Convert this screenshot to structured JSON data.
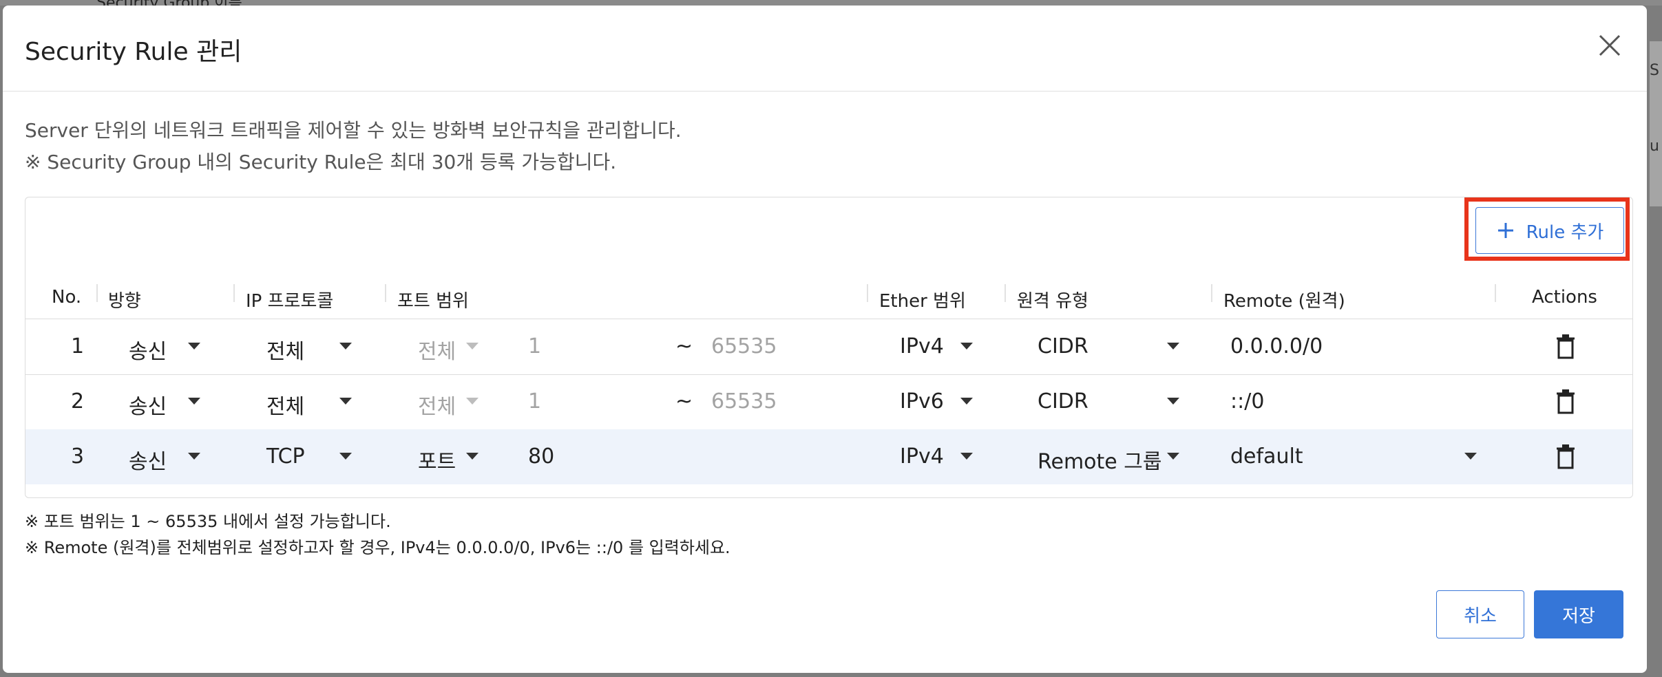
{
  "backdrop": {
    "top_text": "Security Group 이름",
    "right_letter_1": "S",
    "right_letter_2": "u"
  },
  "modal": {
    "title": "Security Rule 관리",
    "description_1": "Server 단위의 네트워크 트래픽을 제어할 수 있는 방화벽 보안규칙을 관리합니다.",
    "description_2": "※ Security Group 내의 Security Rule은 최대 30개 등록 가능합니다.",
    "add_rule_label": "Rule 추가",
    "columns": {
      "no": "No.",
      "direction": "방향",
      "protocol": "IP 프로토콜",
      "port_range": "포트 범위",
      "ether": "Ether 범위",
      "remote_type": "원격 유형",
      "remote": "Remote (원격)",
      "actions": "Actions"
    },
    "rows": [
      {
        "no": "1",
        "direction": "송신",
        "protocol": "전체",
        "port_type": "전체",
        "port_from": "1",
        "tilde": "~",
        "port_to": "65535",
        "ether": "IPv4",
        "remote_type": "CIDR",
        "remote": "0.0.0.0/0"
      },
      {
        "no": "2",
        "direction": "송신",
        "protocol": "전체",
        "port_type": "전체",
        "port_from": "1",
        "tilde": "~",
        "port_to": "65535",
        "ether": "IPv6",
        "remote_type": "CIDR",
        "remote": "::/0"
      },
      {
        "no": "3",
        "direction": "송신",
        "protocol": "TCP",
        "port_type": "포트",
        "port_from": "80",
        "tilde": "",
        "port_to": "",
        "ether": "IPv4",
        "remote_type": "Remote 그룹",
        "remote": "default"
      }
    ],
    "note_1": "※ 포트 범위는 1 ~ 65535 내에서 설정 가능합니다.",
    "note_2": "※ Remote (원격)를 전체범위로 설정하고자 할 경우, IPv4는 0.0.0.0/0, IPv6는 ::/0 를 입력하세요.",
    "cancel_label": "취소",
    "save_label": "저장"
  },
  "colors": {
    "accent": "#3576d8",
    "highlight": "#e8341b",
    "selected_row": "#eef3fb"
  }
}
